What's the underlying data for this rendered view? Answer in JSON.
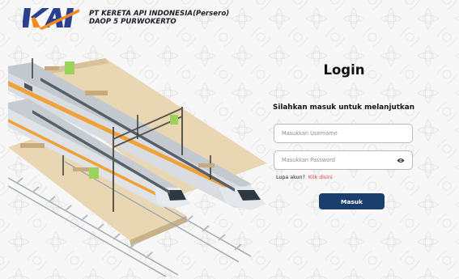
{
  "brand": {
    "logo_text": "KAI",
    "company_line1": "PT KERETA API INDONESIA(Persero)",
    "company_line2": "DAOP 5 PURWOKERTO"
  },
  "login": {
    "title": "Login",
    "subtitle": "Silahkan masuk untuk melanjutkan",
    "username_placeholder": "Masukkan Username",
    "password_placeholder": "Masukkan Password",
    "forgot_text": "Lupa akun?",
    "forgot_link": "Klik disini",
    "submit_label": "Masuk"
  },
  "colors": {
    "primary": "#1a3f6f",
    "link": "#e23a3a",
    "logo_orange": "#f28b22",
    "logo_blue": "#2a3f8f"
  },
  "icons": {
    "password_toggle": "eye-icon"
  }
}
